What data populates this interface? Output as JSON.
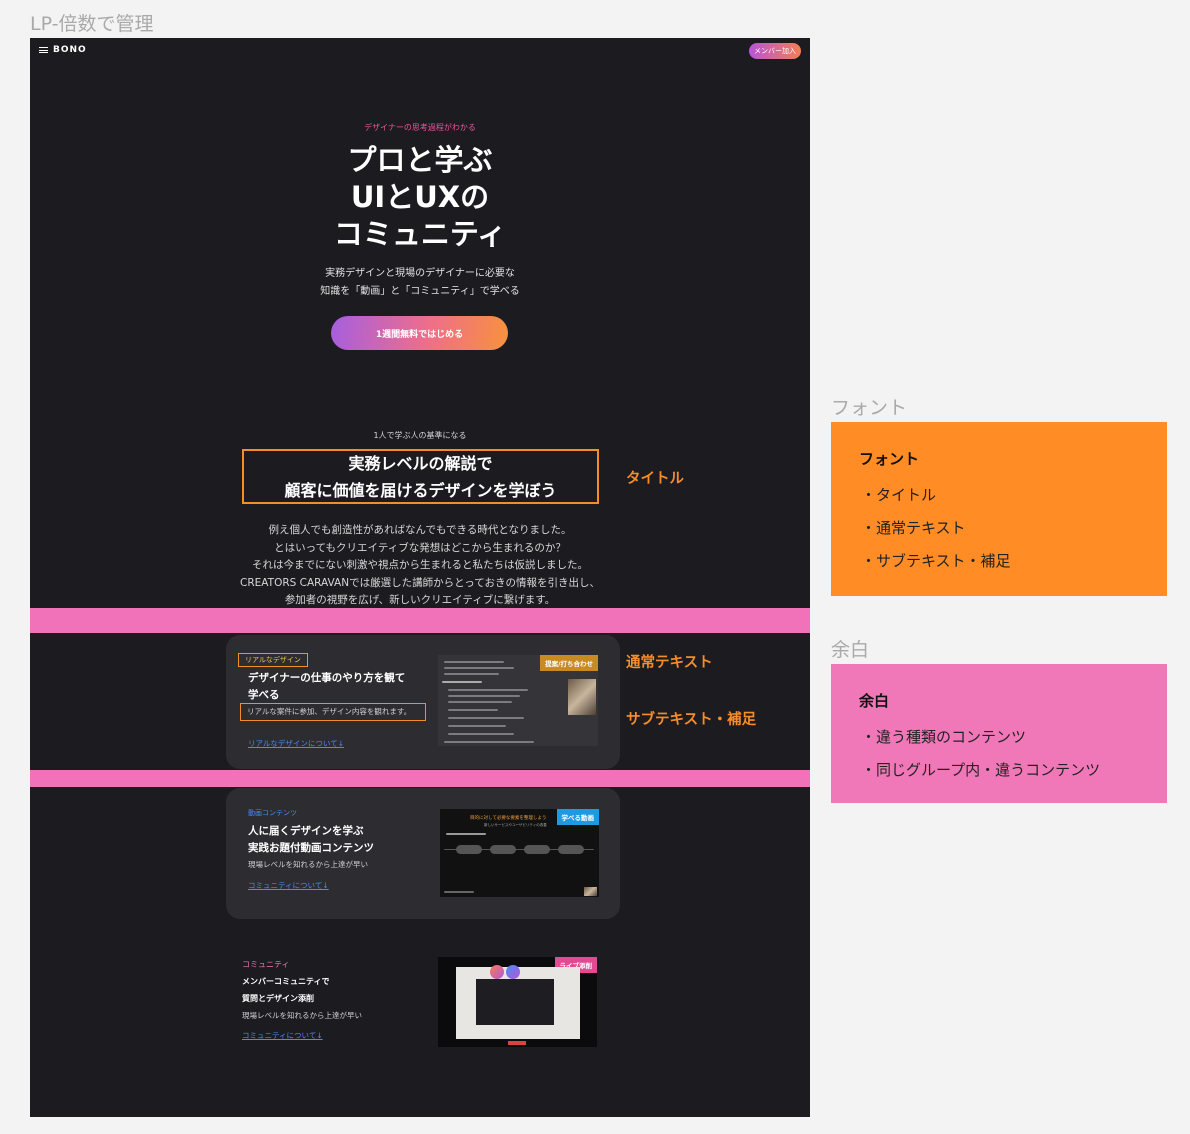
{
  "frame": {
    "title": "LP-倍数で管理"
  },
  "nav": {
    "logo": "BONO",
    "join_label": "メンバー加入"
  },
  "hero": {
    "kicker": "デザイナーの思考過程がわかる",
    "title_lines": [
      "プロと学ぶ",
      "UIとUXの",
      "コミュニティ"
    ],
    "subtitle_lines": [
      "実務デザインと現場のデザイナーに必要な",
      "知識を「動画」と「コミュニティ」で学べる"
    ],
    "cta_label": "1週間無料ではじめる"
  },
  "section2": {
    "kicker": "1人で学ぶ人の基準になる",
    "title_lines": [
      "実務レベルの解説で",
      "顧客に価値を届けるデザインを学ぼう"
    ],
    "body_lines": [
      "例え個人でも創造性があればなんでもできる時代となりました。",
      "とはいってもクリエイティブな発想はどこから生まれるのか？",
      "それは今までにない刺激や視点から生まれると私たちは仮説しました。",
      "CREATORS CARAVANでは厳選した講師からとっておきの情報を引き出し、",
      "参加者の視野を広げ、新しいクリエイティブに繋げます。"
    ]
  },
  "cards": [
    {
      "tag": "リアルなデザイン",
      "title_lines": [
        "デザイナーの仕事のやり方を観て",
        "学べる"
      ],
      "desc": "リアルな案件に参加、デザイン内容を観れます。",
      "link": "リアルなデザインについて↓",
      "ribbon": "提案/打ち合わせ"
    },
    {
      "tag": "動画コンテンツ",
      "title_lines": [
        "人に届くデザインを学ぶ",
        "実践お題付動画コンテンツ"
      ],
      "desc": "現場レベルを知れるから上達が早い",
      "link": "コミュニティについて↓",
      "ribbon": "学べる動画",
      "shot_heading": "目的に対して必要な要素を整理しよう",
      "shot_sub": "新しいサービスやユーザビリティの改善"
    },
    {
      "tag": "コミュニティ",
      "title_lines": [
        "メンバーコミュニティで",
        "質問とデザイン添削"
      ],
      "desc": "現場レベルを知れるから上達が早い",
      "link": "コミュニティについて↓",
      "ribbon": "ライブ添削"
    }
  ],
  "annotations": {
    "title": "タイトル",
    "body_text": "通常テキスト",
    "sub_text": "サブテキスト・補足"
  },
  "legend_font": {
    "label": "フォント",
    "heading": "フォント",
    "items": [
      "・タイトル",
      "・通常テキスト",
      "・サブテキスト・補足"
    ],
    "color": "#ff8c24"
  },
  "legend_margin": {
    "label": "余白",
    "heading": "余白",
    "items": [
      "・違う種類のコンテンツ",
      "・同じグループ内・違うコンテンツ"
    ],
    "color": "#f178b8"
  },
  "colors": {
    "lp_background": "#1c1b20",
    "card_background": "#2d2c31",
    "accent_orange": "#f68d2b",
    "accent_pink": "#f172b9",
    "link_blue": "#4a8bf3"
  }
}
